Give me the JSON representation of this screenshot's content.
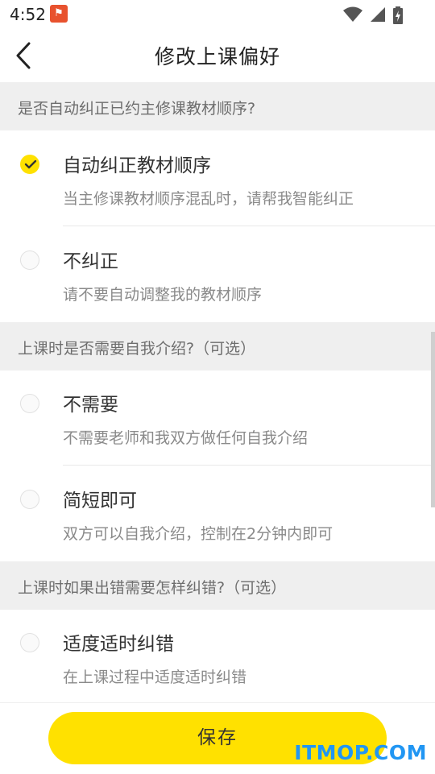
{
  "status_bar": {
    "time": "4:52",
    "app_badge_glyph": "⚑",
    "icons": [
      "wifi-icon",
      "cell-signal-icon",
      "battery-icon"
    ]
  },
  "header": {
    "back_icon": "chevron-left-icon",
    "title": "修改上课偏好"
  },
  "sections": [
    {
      "heading": "是否自动纠正已约主修课教材顺序?",
      "options": [
        {
          "label": "自动纠正教材顺序",
          "desc": "当主修课教材顺序混乱时，请帮我智能纠正",
          "selected": true
        },
        {
          "label": "不纠正",
          "desc": "请不要自动调整我的教材顺序",
          "selected": false
        }
      ]
    },
    {
      "heading": "上课时是否需要自我介绍?（可选）",
      "options": [
        {
          "label": "不需要",
          "desc": "不需要老师和我双方做任何自我介绍",
          "selected": false
        },
        {
          "label": "简短即可",
          "desc": "双方可以自我介绍，控制在2分钟内即可",
          "selected": false
        }
      ]
    },
    {
      "heading": "上课时如果出错需要怎样纠错?（可选）",
      "options": [
        {
          "label": "适度适时纠错",
          "desc": "在上课过程中适度适时纠错",
          "selected": false
        }
      ]
    }
  ],
  "save_label": "保存",
  "watermark": "ITMOP.COM",
  "colors": {
    "accent": "#ffe100",
    "section_bg": "#efefef",
    "watermark": "#2196f3"
  }
}
